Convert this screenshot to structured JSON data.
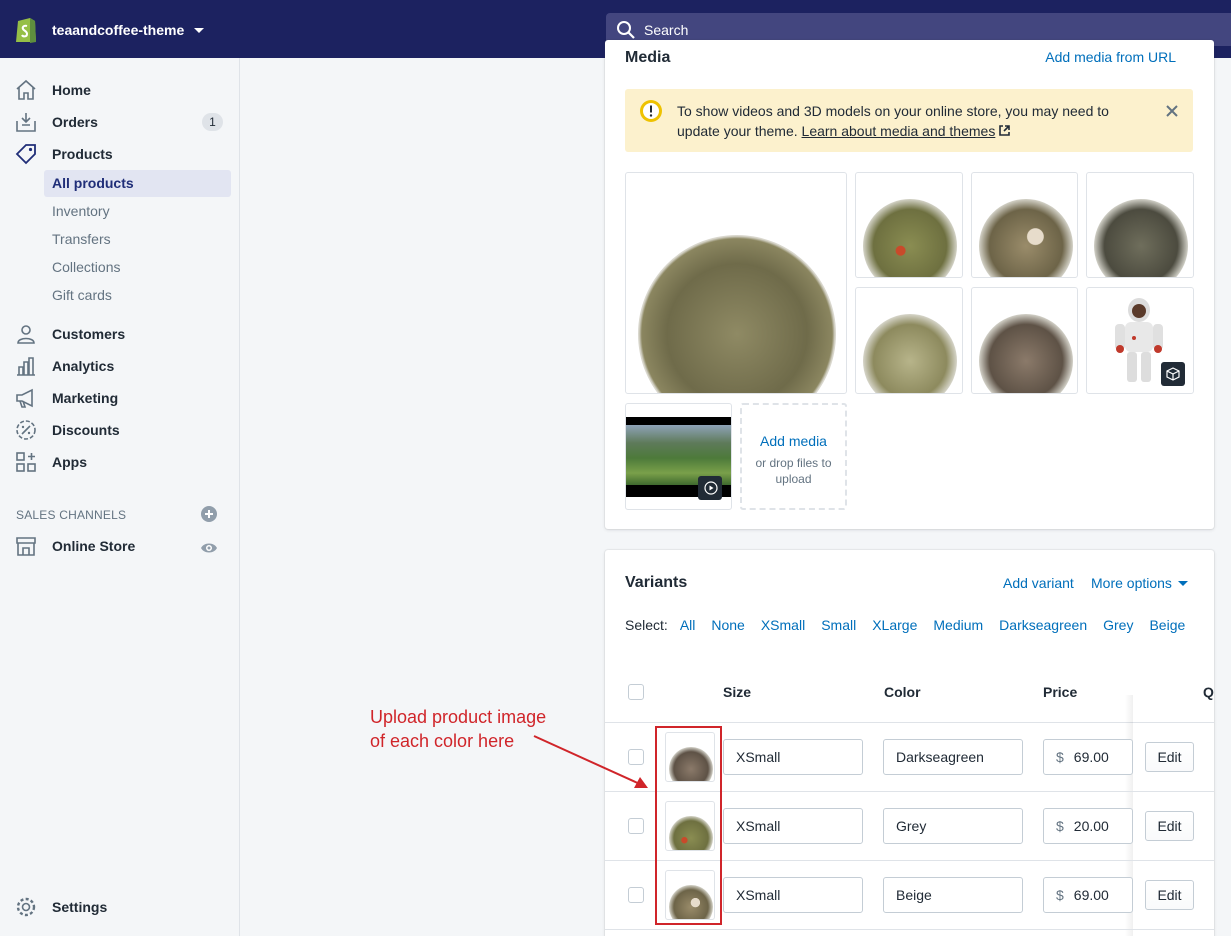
{
  "topbar": {
    "store_name": "teaandcoffee-theme",
    "search_placeholder": "Search"
  },
  "sidebar": {
    "items": [
      {
        "label": "Home",
        "icon": "home-icon"
      },
      {
        "label": "Orders",
        "icon": "orders-icon",
        "badge": "1"
      },
      {
        "label": "Products",
        "icon": "tag-icon"
      },
      {
        "label": "Customers",
        "icon": "person-icon"
      },
      {
        "label": "Analytics",
        "icon": "bar-chart-icon"
      },
      {
        "label": "Marketing",
        "icon": "megaphone-icon"
      },
      {
        "label": "Discounts",
        "icon": "discount-icon"
      },
      {
        "label": "Apps",
        "icon": "apps-icon"
      }
    ],
    "product_subitems": [
      "All products",
      "Inventory",
      "Transfers",
      "Collections",
      "Gift cards"
    ],
    "active_subitem": "All products",
    "sales_channels_label": "SALES CHANNELS",
    "online_store_label": "Online Store",
    "settings_label": "Settings"
  },
  "media": {
    "title": "Media",
    "add_from_url": "Add media from URL",
    "banner_text": "To show videos and 3D models on your online store, you may need to update your theme.",
    "banner_link": "Learn about media and themes",
    "add_media_label": "Add media",
    "drop_files_label": "or drop files to upload"
  },
  "variants": {
    "title": "Variants",
    "add_variant": "Add variant",
    "more_options": "More options",
    "select_label": "Select:",
    "select_options": [
      "All",
      "None",
      "XSmall",
      "Small",
      "XLarge",
      "Medium",
      "Darkseagreen",
      "Grey",
      "Beige"
    ],
    "columns": {
      "size": "Size",
      "color": "Color",
      "price": "Price",
      "quantity_cut": "Q"
    },
    "rows": [
      {
        "size": "XSmall",
        "color": "Darkseagreen",
        "currency": "$",
        "price": "69.00",
        "edit": "Edit"
      },
      {
        "size": "XSmall",
        "color": "Grey",
        "currency": "$",
        "price": "20.00",
        "edit": "Edit"
      },
      {
        "size": "XSmall",
        "color": "Beige",
        "currency": "$",
        "price": "69.00",
        "edit": "Edit"
      }
    ]
  },
  "annotation": {
    "line1": "Upload product image",
    "line2": "of each color here",
    "color": "#d0252a"
  },
  "colors": {
    "topbar": "#1c2260",
    "search_bg": "#43467f",
    "link": "#006fbb",
    "banner_bg": "#fcf1cd",
    "active_nav": "#202e78"
  }
}
